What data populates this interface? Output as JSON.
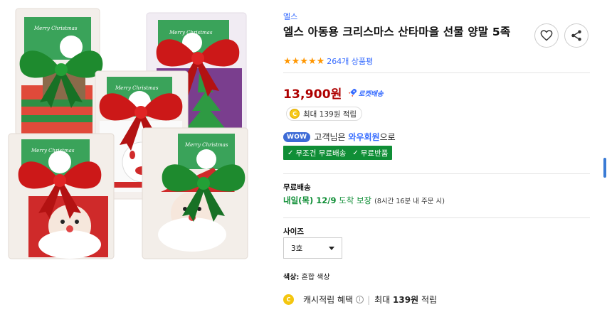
{
  "product": {
    "brand": "엘스",
    "title": "엘스 아동용 크리스마스 산타마을 선물 양말 5족",
    "rating_stars": 5,
    "review_count": "264개 상품평",
    "price": "13,900원",
    "delivery_badge": "로켓배송",
    "reward_text": "최대 139원 적립"
  },
  "membership": {
    "badge": "WOW",
    "text_prefix": "고객님은",
    "member_name": "와우회원",
    "text_suffix": "으로",
    "benefits": [
      "무조건 무료배송",
      "무료반품"
    ]
  },
  "shipping": {
    "title": "무료배송",
    "arrival_bold": "내일(목) 12/9",
    "arrival_text": "도착 보장",
    "note": "(8시간 16분 내 주문 시)"
  },
  "option": {
    "size_label": "사이즈",
    "size_value": "3호",
    "color_label": "색상:",
    "color_value": "혼합 색상"
  },
  "cash": {
    "label": "캐시적립 혜택",
    "info_icon": "i",
    "amount_prefix": "최대",
    "amount": "139원",
    "amount_suffix": "적립"
  },
  "image_text": {
    "card_label": "Merry Christmas"
  },
  "colors": {
    "accent_blue": "#346aff",
    "price_red": "#ae0000",
    "wow_green": "#0f8e36",
    "star_orange": "#ff9600"
  },
  "icons": {
    "heart": "heart-icon",
    "share": "share-icon",
    "rocket": "rocket-icon",
    "coin": "coin-icon",
    "check": "check-icon",
    "caret": "chevron-down-icon"
  }
}
